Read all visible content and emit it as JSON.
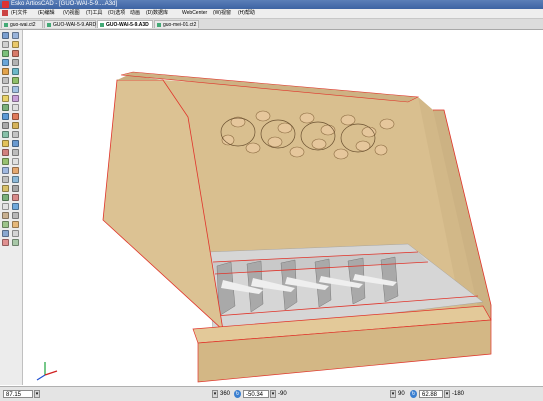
{
  "window": {
    "title": "Esko ArtiosCAD - [GUO-WAI-5-9....A3d]"
  },
  "menu": [
    {
      "label": "(F)文件"
    },
    {
      "label": "(E)编辑"
    },
    {
      "label": "(V)视图"
    },
    {
      "label": "(T)工具"
    },
    {
      "label": "(O)选项"
    },
    {
      "label": "动画"
    },
    {
      "label": "(D)数据库"
    },
    {
      "label": "WebCenter"
    },
    {
      "label": "(W)视窗"
    },
    {
      "label": "(H)帮助"
    }
  ],
  "tabs": [
    {
      "label": "guo-wai.ct2",
      "active": false
    },
    {
      "label": "GUO-WAI-5-9.ARD",
      "active": false
    },
    {
      "label": "GUO-WAI-5-9.A3D",
      "active": true
    },
    {
      "label": "guo-mei-01.ct2",
      "active": false
    }
  ],
  "status": {
    "zoom": "87.15",
    "rot_x_value": "360",
    "rot_y_value": "-50.34",
    "rot_y_right": "-90",
    "rot_z_value": "90",
    "rot_z_field": "62.88",
    "rot_z_right": "-180"
  },
  "colors": {
    "board_face": "#d9bf8f",
    "board_side": "#c8ad7f",
    "edge_red": "#e0342a",
    "inner_floor": "#d6d6d6"
  }
}
